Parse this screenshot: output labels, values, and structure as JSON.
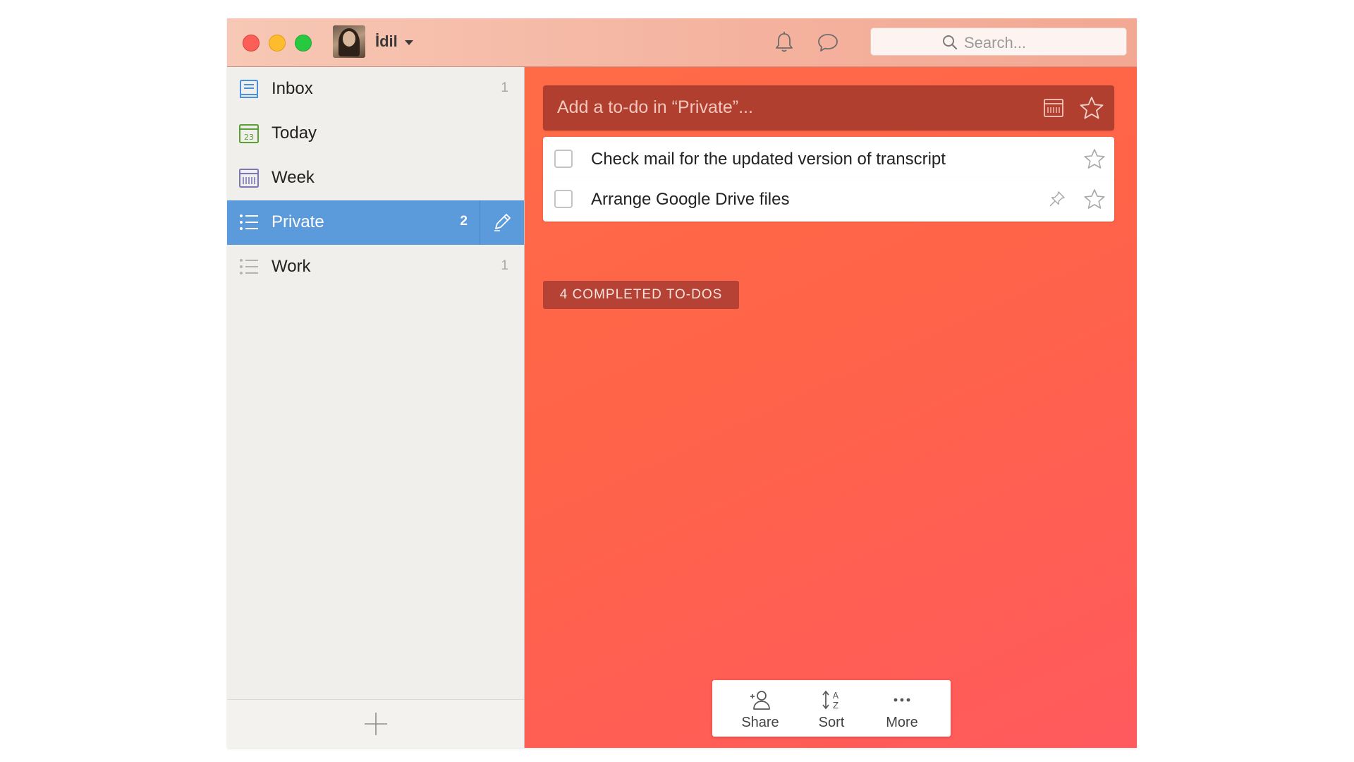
{
  "titlebar": {
    "username": "İdil",
    "search_placeholder": "Search..."
  },
  "sidebar": {
    "items": [
      {
        "label": "Inbox",
        "count": "1",
        "icon": "inbox-icon"
      },
      {
        "label": "Today",
        "count": "",
        "icon": "calendar-today-icon",
        "icon_text": "23"
      },
      {
        "label": "Week",
        "count": "",
        "icon": "calendar-week-icon"
      },
      {
        "label": "Private",
        "count": "2",
        "icon": "list-icon",
        "active": true
      },
      {
        "label": "Work",
        "count": "1",
        "icon": "list-icon"
      }
    ],
    "active_color": "#5b9bdb"
  },
  "main": {
    "add_placeholder": "Add a to-do in “Private”...",
    "tasks": [
      {
        "title": "Check mail for the updated version of transcript",
        "starred": false
      },
      {
        "title": "Arrange Google Drive files",
        "starred": false,
        "pinned": true
      }
    ],
    "completed_label": "4 COMPLETED TO-DOS",
    "toolbar": {
      "share": "Share",
      "sort": "Sort",
      "more": "More"
    },
    "background_colors": [
      "#ff6b47",
      "#ff5a5e"
    ]
  }
}
